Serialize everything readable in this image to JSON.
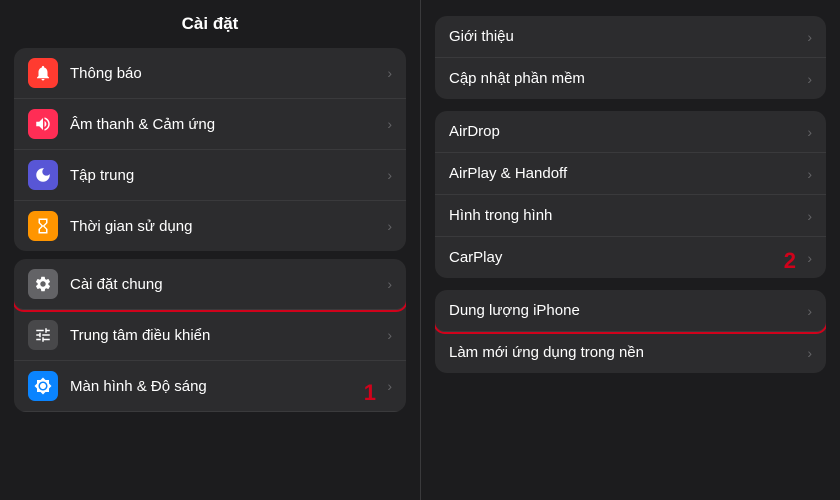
{
  "left": {
    "title": "Cài đặt",
    "group1": [
      {
        "id": "notifications",
        "label": "Thông báo",
        "iconColor": "#ff3b30",
        "icon": "bell"
      },
      {
        "id": "sounds",
        "label": "Âm thanh & Cảm ứng",
        "iconColor": "#ff2d55",
        "icon": "sound"
      },
      {
        "id": "focus",
        "label": "Tập trung",
        "iconColor": "#5856d6",
        "icon": "moon"
      },
      {
        "id": "screentime",
        "label": "Thời gian sử dụng",
        "iconColor": "#ff9500",
        "icon": "hourglass"
      }
    ],
    "group2": [
      {
        "id": "general",
        "label": "Cài đặt chung",
        "iconColor": "#636366",
        "icon": "gear",
        "highlighted": true
      },
      {
        "id": "controlcenter",
        "label": "Trung tâm điều khiển",
        "iconColor": "#636366",
        "icon": "sliders"
      },
      {
        "id": "display",
        "label": "Màn hình & Độ sáng",
        "iconColor": "#0a84ff",
        "icon": "sun"
      }
    ],
    "badge": "1"
  },
  "right": {
    "group1": [
      {
        "id": "about",
        "label": "Giới thiệu"
      },
      {
        "id": "software",
        "label": "Cập nhật phần mềm"
      }
    ],
    "group2": [
      {
        "id": "airdrop",
        "label": "AirDrop"
      },
      {
        "id": "airplay",
        "label": "AirPlay & Handoff"
      },
      {
        "id": "pip",
        "label": "Hình trong hình"
      },
      {
        "id": "carplay",
        "label": "CarPlay"
      }
    ],
    "group3": [
      {
        "id": "storage",
        "label": "Dung lượng iPhone",
        "highlighted": true
      },
      {
        "id": "background",
        "label": "Làm mới ứng dụng trong nền"
      }
    ],
    "badge": "2"
  }
}
